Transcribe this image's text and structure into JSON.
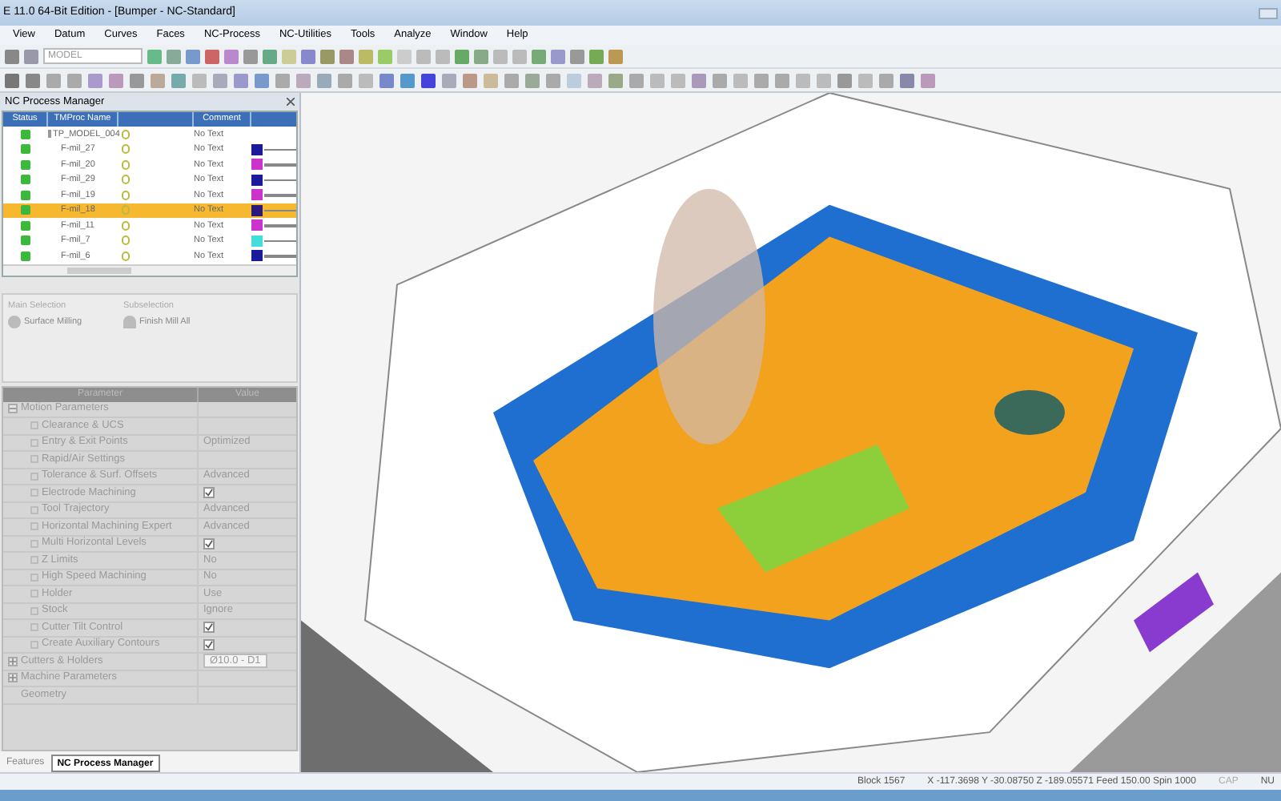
{
  "window": {
    "title": "E 11.0 64-Bit Edition - [Bumper - NC-Standard]"
  },
  "menu": [
    "View",
    "Datum",
    "Curves",
    "Faces",
    "NC-Process",
    "NC-Utilities",
    "Tools",
    "Analyze",
    "Window",
    "Help"
  ],
  "toolbar": {
    "combo_value": "MODEL"
  },
  "nc_process_manager": {
    "title": "NC Process Manager",
    "columns": [
      "Status",
      "TMProc Name",
      "Comment"
    ],
    "rows": [
      {
        "name": "TP_MODEL_004",
        "comment": "No Text",
        "selected": false
      },
      {
        "name": "F-mil_27",
        "comment": "No Text",
        "selected": false,
        "color": "#1a1a9a"
      },
      {
        "name": "F-mil_20",
        "comment": "No Text",
        "selected": false,
        "color": "#cc33cc"
      },
      {
        "name": "F-mil_29",
        "comment": "No Text",
        "selected": false,
        "color": "#1a1a9a"
      },
      {
        "name": "F-mil_19",
        "comment": "No Text",
        "selected": false,
        "color": "#cc33cc"
      },
      {
        "name": "F-mil_18",
        "comment": "No Text",
        "selected": true,
        "color": "#2a1a7a"
      },
      {
        "name": "F-mil_11",
        "comment": "No Text",
        "selected": false,
        "color": "#cc33cc"
      },
      {
        "name": "F-mil_7",
        "comment": "No Text",
        "selected": false,
        "color": "#44dddd"
      },
      {
        "name": "F-mil_6",
        "comment": "No Text",
        "selected": false,
        "color": "#1a1a9a"
      }
    ]
  },
  "selection": {
    "main_label": "Main Selection",
    "main_value": "Surface Milling",
    "sub_label": "Subselection",
    "sub_value": "Finish Mill All"
  },
  "parameters": {
    "columns": [
      "Parameter",
      "Value"
    ],
    "items": [
      {
        "label": "Motion Parameters",
        "expanded": true,
        "children": [
          {
            "label": "Clearance & UCS"
          },
          {
            "label": "Entry & Exit Points",
            "value": "Optimized"
          },
          {
            "label": "Rapid/Air Settings"
          },
          {
            "label": "Tolerance & Surf. Offsets",
            "value": "Advanced"
          },
          {
            "label": "Electrode Machining",
            "checked": true
          },
          {
            "label": "Tool Trajectory",
            "value": "Advanced"
          },
          {
            "label": "Horizontal Machining Expert",
            "value": "Advanced"
          },
          {
            "label": "Multi Horizontal Levels",
            "checked": true
          },
          {
            "label": "Z Limits",
            "value": "No"
          },
          {
            "label": "High Speed Machining",
            "value": "No"
          },
          {
            "label": "Holder",
            "value": "Use"
          },
          {
            "label": "Stock",
            "value": "Ignore"
          },
          {
            "label": "Cutter Tilt Control",
            "checked": true
          },
          {
            "label": "Create Auxiliary Contours",
            "checked": true
          }
        ]
      },
      {
        "label": "Cutters & Holders",
        "expanded": false,
        "value": "Ø10.0 - D1"
      },
      {
        "label": "Machine Parameters",
        "expanded": false
      },
      {
        "label": "Geometry"
      }
    ]
  },
  "tabs": [
    {
      "label": "Features",
      "selected": false
    },
    {
      "label": "NC Process Manager",
      "selected": true
    }
  ],
  "status_bar": {
    "block": "Block 1567",
    "coords": "X -117.3698 Y -30.08750 Z -189.05571 Feed 150.00 Spin 1000",
    "caps": "CAP",
    "num": "NU"
  }
}
